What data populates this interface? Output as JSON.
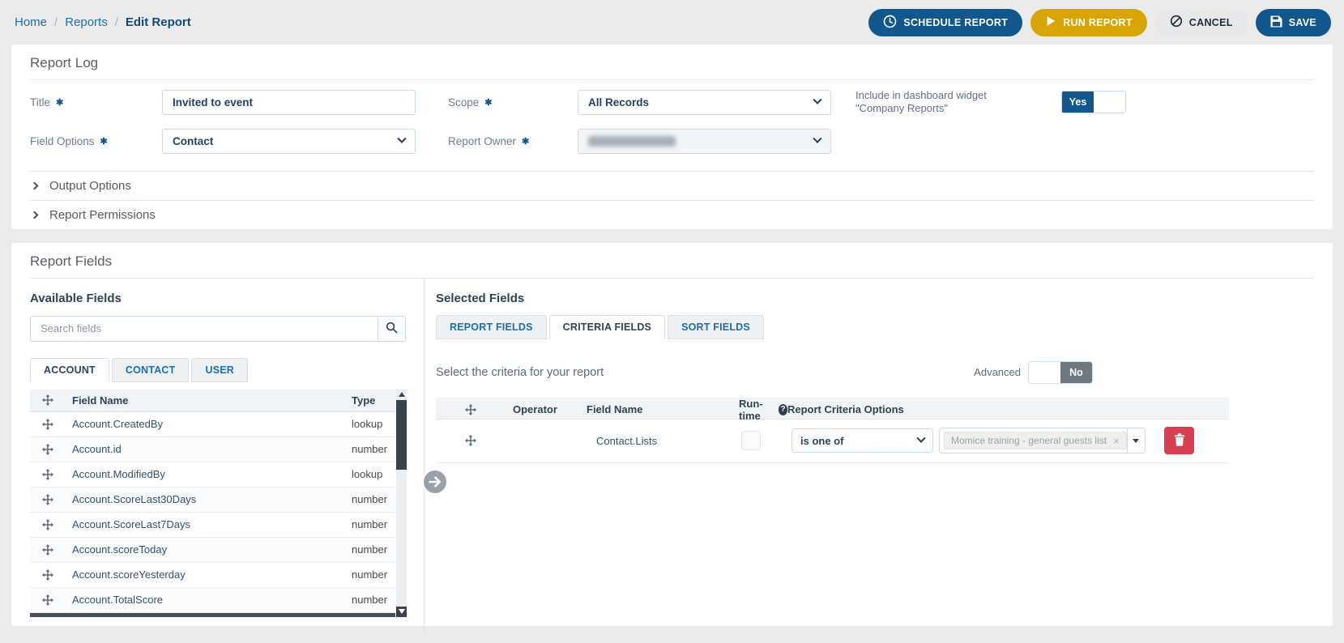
{
  "ui": {
    "required_marker": "✱",
    "breadcrumb_separator": "/",
    "help_glyph": "?",
    "tag_remove_glyph": "×"
  },
  "breadcrumb": {
    "home": "Home",
    "reports": "Reports",
    "current": "Edit Report"
  },
  "actions": {
    "schedule_report": "SCHEDULE REPORT",
    "run_report": "RUN REPORT",
    "cancel": "CANCEL",
    "save": "SAVE"
  },
  "report_log": {
    "section_title": "Report Log",
    "title_label": "Title",
    "title_value": "Invited to event",
    "field_options_label": "Field Options",
    "field_options_value": "Contact",
    "scope_label": "Scope",
    "scope_value": "All Records",
    "report_owner_label": "Report Owner",
    "dashboard_widget_label": "Include in dashboard widget \"Company Reports\"",
    "dashboard_widget_value": "Yes",
    "output_options_label": "Output Options",
    "report_permissions_label": "Report Permissions"
  },
  "report_fields": {
    "section_title": "Report Fields",
    "available": {
      "heading": "Available Fields",
      "search_placeholder": "Search fields",
      "tabs": {
        "account": "ACCOUNT",
        "contact": "CONTACT",
        "user": "USER"
      },
      "columns": {
        "field_name": "Field Name",
        "type": "Type"
      },
      "rows": [
        {
          "name": "Account.CreatedBy",
          "type": "lookup"
        },
        {
          "name": "Account.id",
          "type": "number"
        },
        {
          "name": "Account.ModifiedBy",
          "type": "lookup"
        },
        {
          "name": "Account.ScoreLast30Days",
          "type": "number"
        },
        {
          "name": "Account.ScoreLast7Days",
          "type": "number"
        },
        {
          "name": "Account.scoreToday",
          "type": "number"
        },
        {
          "name": "Account.scoreYesterday",
          "type": "number"
        },
        {
          "name": "Account.TotalScore",
          "type": "number"
        }
      ]
    },
    "selected": {
      "heading": "Selected Fields",
      "tabs": {
        "report": "REPORT FIELDS",
        "criteria": "CRITERIA FIELDS",
        "sort": "SORT FIELDS"
      },
      "intro": "Select the criteria for your report",
      "advanced_label": "Advanced",
      "advanced_value": "No",
      "columns": {
        "operator": "Operator",
        "field_name": "Field Name",
        "runtime": "Run-time",
        "options": "Report Criteria Options"
      },
      "row": {
        "field_name": "Contact.Lists",
        "operator_value": "is one of",
        "selected_option": "Momice training - general guests list"
      }
    }
  },
  "colors": {
    "primary": "#11568c",
    "accent_gold": "#d9a506",
    "danger": "#d9404f"
  }
}
